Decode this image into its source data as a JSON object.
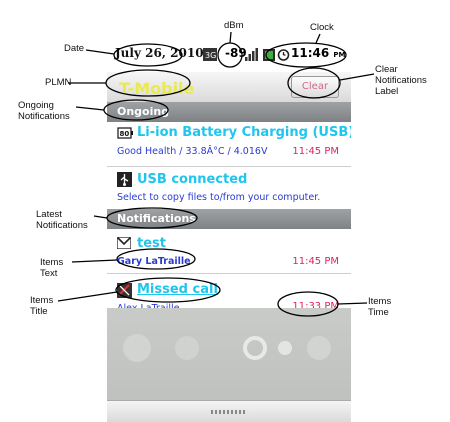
{
  "annotations": {
    "date": "Date",
    "dbm": "dBm",
    "clock": "Clock",
    "plmn": "PLMN",
    "clear_label": "Clear Notifications Label",
    "ongoing": "Ongoing Notifications",
    "latest": "Latest Notifications",
    "items_text": "Items Text",
    "items_title": "Items Title",
    "items_time": "Items Time"
  },
  "status_bar": {
    "date": "July 26, 2010",
    "signal_dbm": "-89",
    "clock": "11:46",
    "clock_ampm": "PM",
    "icons": [
      "3g-icon",
      "signal-bars-icon",
      "battery-icon",
      "alarm-icon"
    ]
  },
  "plmn": {
    "name": "T-Mobile",
    "clear_label": "Clear"
  },
  "ongoing": {
    "header": "Ongoing",
    "items": [
      {
        "icon": "battery-80-icon",
        "icon_text": "80",
        "title": "Li-ion Battery Charging (USB)",
        "text": "Good Health / 33.8Â°C / 4.016V",
        "time": "11:45 PM"
      },
      {
        "icon": "usb-icon",
        "title": "USB connected",
        "text": "Select to copy files to/from your computer.",
        "time": ""
      }
    ]
  },
  "latest": {
    "header": "Notifications",
    "items": [
      {
        "icon": "gmail-icon",
        "title": "test",
        "text": "Gary LaTraille",
        "time": "11:45 PM"
      },
      {
        "icon": "missed-call-icon",
        "title": "Missed call",
        "text": "Alex LaTraille",
        "time": "11:33 PM"
      }
    ]
  },
  "colors": {
    "title": "#1ec6ee",
    "text": "#2a3bd0",
    "time": "#e0245a",
    "plmn": "#eaea50",
    "header": "#8c8f91"
  }
}
